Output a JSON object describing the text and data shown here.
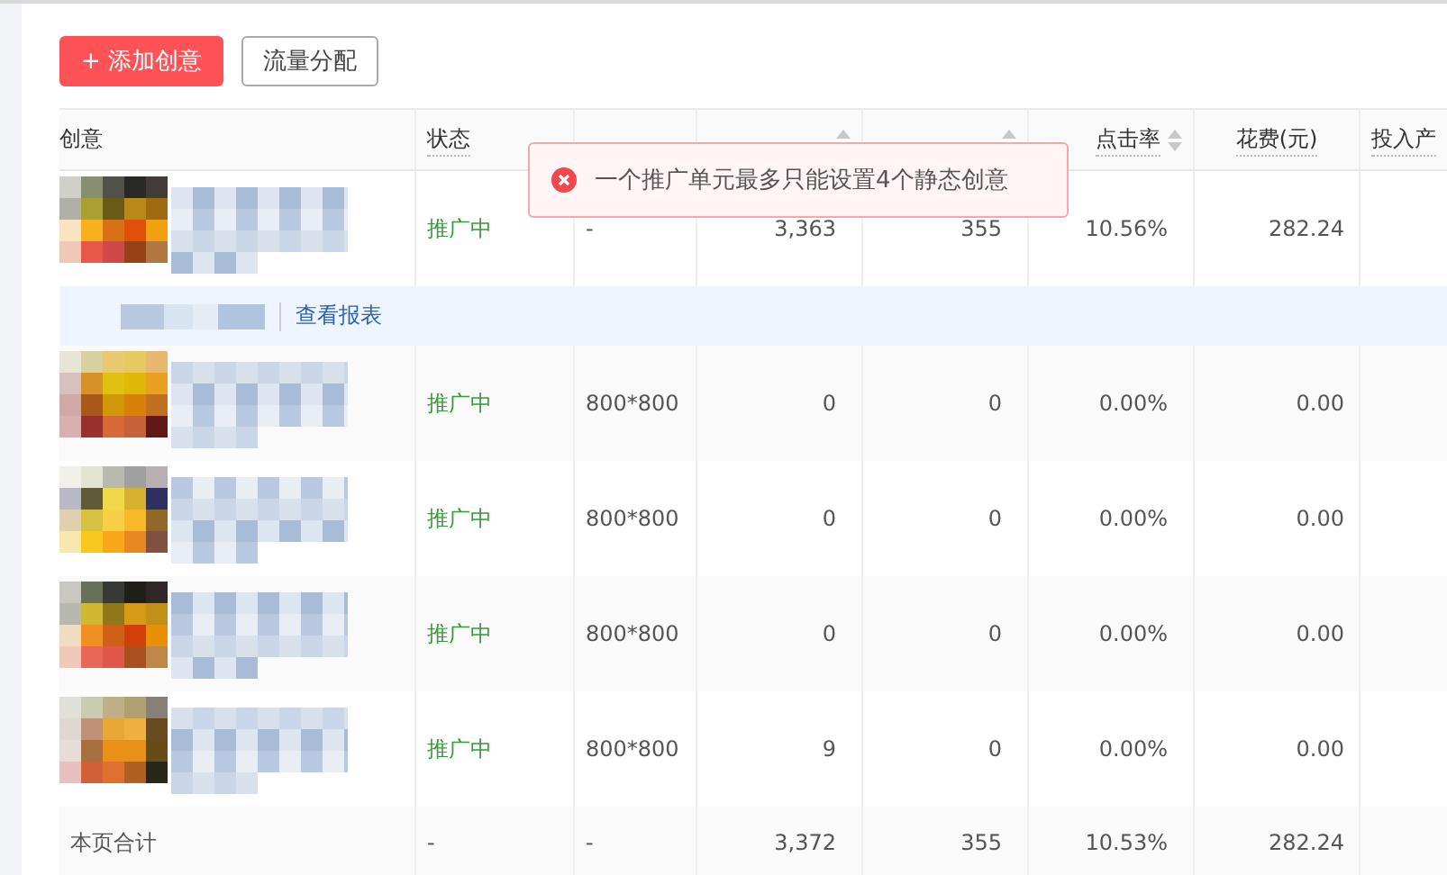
{
  "toolbar": {
    "buttons": [
      {
        "label": "+ 添加创意",
        "kind": "primary"
      },
      {
        "label": "流量分配",
        "kind": "default"
      }
    ]
  },
  "table": {
    "columns": [
      {
        "label": "创意",
        "sortable": false
      },
      {
        "label": "状态",
        "sortable": false
      },
      {
        "sortable": false
      },
      {
        "sortable": true
      },
      {
        "sortable": true
      },
      {
        "label": "点击率",
        "sortable": true
      },
      {
        "label": "花费(元)",
        "sortable": false
      },
      {
        "label": "投入产",
        "sortable": false
      }
    ],
    "rows": [
      {
        "kind": "creative",
        "status": "推广中",
        "size": "-",
        "impressions": "3,363",
        "clicks": "355",
        "ctr": "10.56%",
        "cost": "282.24",
        "actions": [
          "查看报表"
        ]
      },
      {
        "kind": "creative",
        "status": "推广中",
        "size": "800*800",
        "impressions": "0",
        "clicks": "0",
        "ctr": "0.00%",
        "cost": "0.00"
      },
      {
        "kind": "creative",
        "status": "推广中",
        "size": "800*800",
        "impressions": "0",
        "clicks": "0",
        "ctr": "0.00%",
        "cost": "0.00"
      },
      {
        "kind": "creative",
        "status": "推广中",
        "size": "800*800",
        "impressions": "0",
        "clicks": "0",
        "ctr": "0.00%",
        "cost": "0.00"
      },
      {
        "kind": "creative",
        "status": "推广中",
        "size": "800*800",
        "impressions": "9",
        "clicks": "0",
        "ctr": "0.00%",
        "cost": "0.00"
      }
    ],
    "total": {
      "label": "本页合计",
      "status": "-",
      "size": "-",
      "impressions": "3,372",
      "clicks": "355",
      "ctr": "10.53%",
      "cost": "282.24"
    }
  },
  "toast": {
    "kind": "error",
    "message": "一个推广单元最多只能设置4个静态创意"
  }
}
